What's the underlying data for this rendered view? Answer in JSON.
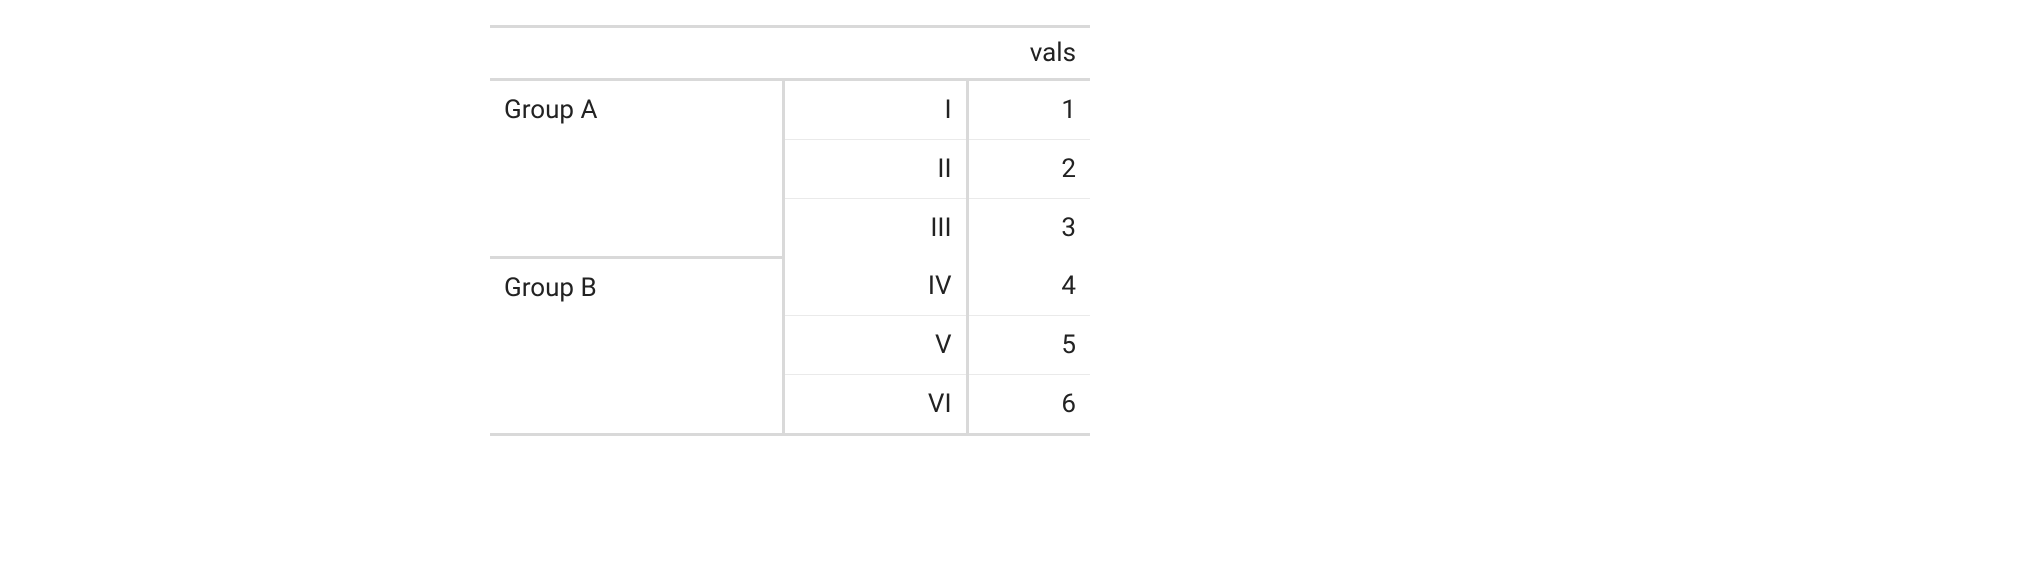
{
  "chart_data": {
    "type": "table",
    "columns": [
      "",
      "",
      "vals"
    ],
    "groups": [
      {
        "name": "Group A",
        "rows": [
          {
            "sub": "I",
            "val": 1
          },
          {
            "sub": "II",
            "val": 2
          },
          {
            "sub": "III",
            "val": 3
          }
        ]
      },
      {
        "name": "Group B",
        "rows": [
          {
            "sub": "IV",
            "val": 4
          },
          {
            "sub": "V",
            "val": 5
          },
          {
            "sub": "VI",
            "val": 6
          }
        ]
      }
    ]
  },
  "header": {
    "vals_label": "vals"
  },
  "groups": {
    "0": {
      "name": "Group A",
      "rows": {
        "0": {
          "sub": "I",
          "val": "1"
        },
        "1": {
          "sub": "II",
          "val": "2"
        },
        "2": {
          "sub": "III",
          "val": "3"
        }
      }
    },
    "1": {
      "name": "Group B",
      "rows": {
        "0": {
          "sub": "IV",
          "val": "4"
        },
        "1": {
          "sub": "V",
          "val": "5"
        },
        "2": {
          "sub": "VI",
          "val": "6"
        }
      }
    }
  }
}
